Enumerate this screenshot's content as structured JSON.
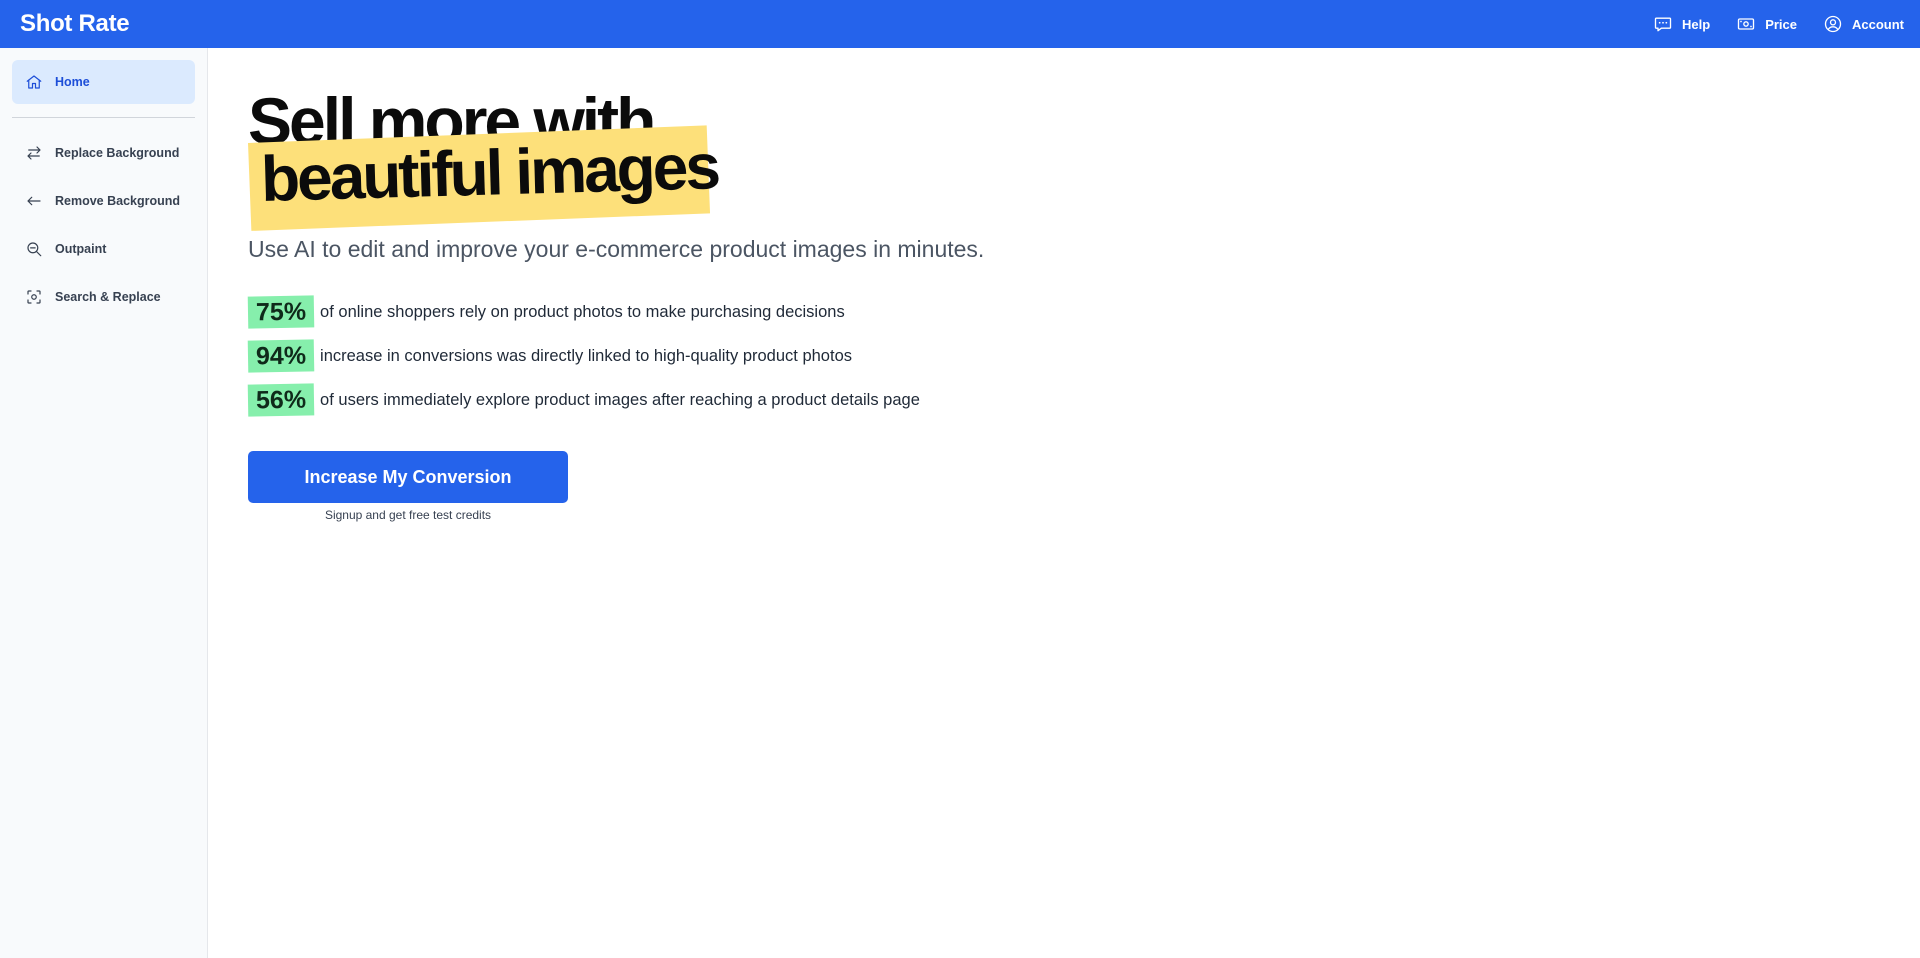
{
  "header": {
    "brand": "Shot Rate",
    "nav": [
      {
        "label": "Help",
        "icon": "chat-bubble-icon"
      },
      {
        "label": "Price",
        "icon": "banknote-icon"
      },
      {
        "label": "Account",
        "icon": "user-circle-icon"
      }
    ],
    "color": "#2563eb"
  },
  "sidebar": {
    "items": [
      {
        "label": "Home",
        "icon": "home-icon",
        "active": true
      },
      {
        "label": "Replace Background",
        "icon": "arrows-swap-icon"
      },
      {
        "label": "Remove Background",
        "icon": "arrow-left-icon"
      },
      {
        "label": "Outpaint",
        "icon": "zoom-out-icon"
      },
      {
        "label": "Search & Replace",
        "icon": "scan-focus-icon"
      }
    ]
  },
  "hero": {
    "headline_line1": "Sell more with",
    "headline_line2": "beautiful images",
    "highlight_color": "#fde07a",
    "subtitle": "Use AI to edit and improve your e-commerce product images in minutes.",
    "stats": [
      {
        "value": "75%",
        "text": "of online shoppers rely on product photos to make purchasing decisions"
      },
      {
        "value": "94%",
        "text": "increase in conversions was directly linked to high-quality product photos"
      },
      {
        "value": "56%",
        "text": "of users immediately explore product images after reaching a product details page"
      }
    ],
    "stat_badge_color": "#86efac",
    "cta_label": "Increase My Conversion",
    "cta_note": "Signup and get free test credits"
  }
}
